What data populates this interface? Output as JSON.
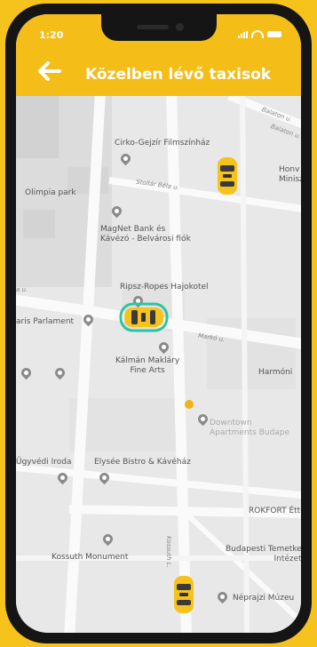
{
  "status": {
    "time": "1:20"
  },
  "header": {
    "title": "Közelben lévő taxisok"
  },
  "colors": {
    "accent": "#f4bd17",
    "taxi": "#f6c21c",
    "selected": "#2fc3a0",
    "location_dot": "#f2b21a"
  },
  "map": {
    "places": [
      "Cirko-Gejzír Filmszínház",
      "Olimpia park",
      "MagNet Bank és\nKávézó - Belvárosi fiók",
      "Ripsz-Ropes Hajokotel",
      "aris Parlament",
      "Kálmán Makláry\nFine Arts",
      "Harmóni",
      "Downtown\nApartments Budape",
      "Ügyvédi Iroda",
      "Elysée Bistro & Kávéház",
      "ROKFORT Étte",
      "Kossuth Monument",
      "Budapesti Temetke\nIntézet",
      "Néprajzi Múzeu",
      "Honv\nMinisz"
    ],
    "streets": [
      "Balaton u.",
      "Balaton u.",
      "Stollár Béla u.",
      "Markó u.",
      "Kossuth L.",
      "a u."
    ],
    "taxis": [
      {
        "name": "taxi-1",
        "selected": false
      },
      {
        "name": "taxi-2",
        "selected": true
      },
      {
        "name": "taxi-3",
        "selected": false
      }
    ]
  }
}
